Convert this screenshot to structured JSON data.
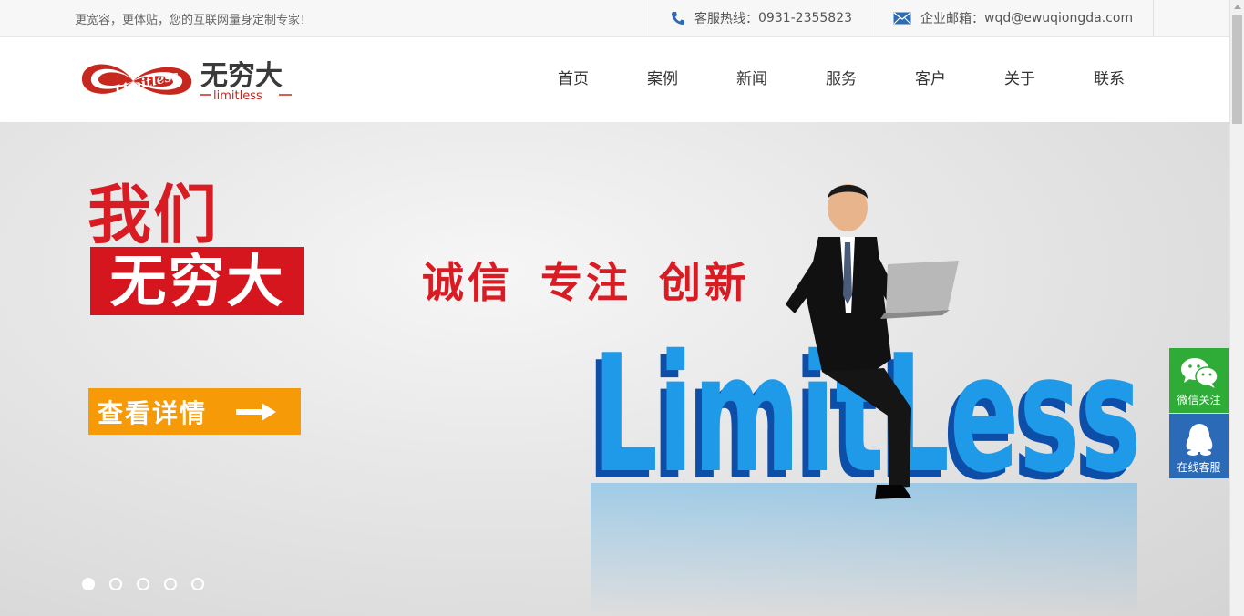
{
  "topbar": {
    "tagline": "更宽容，更体贴，您的互联网量身定制专家！",
    "phone_label": "客服热线：",
    "phone_number": "0931-2355823",
    "email_label": "企业邮箱：",
    "email_address": "wqd@ewuqiongda.com"
  },
  "logo": {
    "script_text": "Limitless",
    "cn_text": "无穷大",
    "en_text": "limitless"
  },
  "nav": {
    "items": [
      {
        "label": "首页"
      },
      {
        "label": "案例"
      },
      {
        "label": "新闻"
      },
      {
        "label": "服务"
      },
      {
        "label": "客户"
      },
      {
        "label": "关于"
      },
      {
        "label": "联系"
      }
    ]
  },
  "banner": {
    "line1": "我们",
    "brand": "无穷大",
    "slogan": "诚信 专注 创新",
    "cta_label": "查看详情",
    "art_text": "LimitLess",
    "slides": 5,
    "active_slide": 1
  },
  "side": {
    "wechat_label": "微信关注",
    "qq_label": "在线客服"
  },
  "colors": {
    "brand_red": "#d5161f",
    "cta_orange": "#f79a08",
    "wechat_green": "#2fab38",
    "qq_blue": "#2a6ab7",
    "art_blue": "#1e9ae8"
  }
}
